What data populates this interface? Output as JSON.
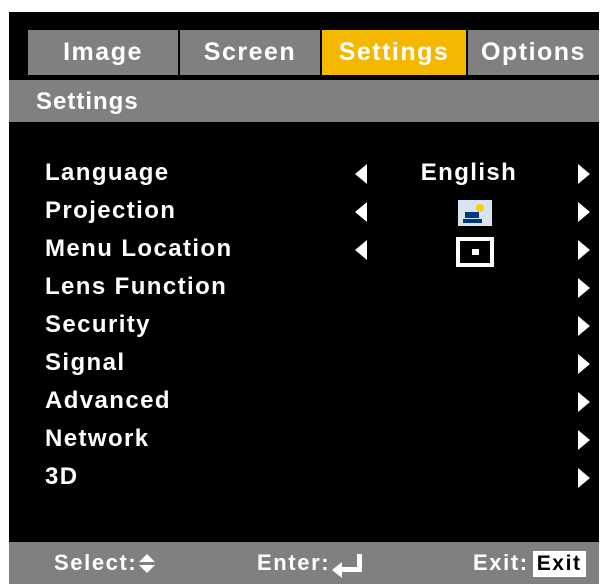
{
  "tabs": [
    {
      "label": "Image",
      "active": false
    },
    {
      "label": "Screen",
      "active": false
    },
    {
      "label": "Settings",
      "active": true
    },
    {
      "label": "Options",
      "active": false
    }
  ],
  "section_title": "Settings",
  "rows": [
    {
      "label": "Language",
      "value": "English",
      "has_left_arrow": true
    },
    {
      "label": "Projection",
      "value_icon": "front-desktop-projection-icon",
      "has_left_arrow": true
    },
    {
      "label": "Menu Location",
      "value_icon": "menu-center-location-icon",
      "has_left_arrow": true
    },
    {
      "label": "Lens Function"
    },
    {
      "label": "Security"
    },
    {
      "label": "Signal"
    },
    {
      "label": "Advanced"
    },
    {
      "label": "Network"
    },
    {
      "label": "3D"
    }
  ],
  "footer": {
    "select_label": "Select:",
    "enter_label": "Enter:",
    "exit_label": "Exit:",
    "exit_key": "Exit"
  },
  "colors": {
    "active_tab": "#f5b800",
    "inactive_tab": "#808080",
    "background": "#000000",
    "text": "#ffffff"
  }
}
